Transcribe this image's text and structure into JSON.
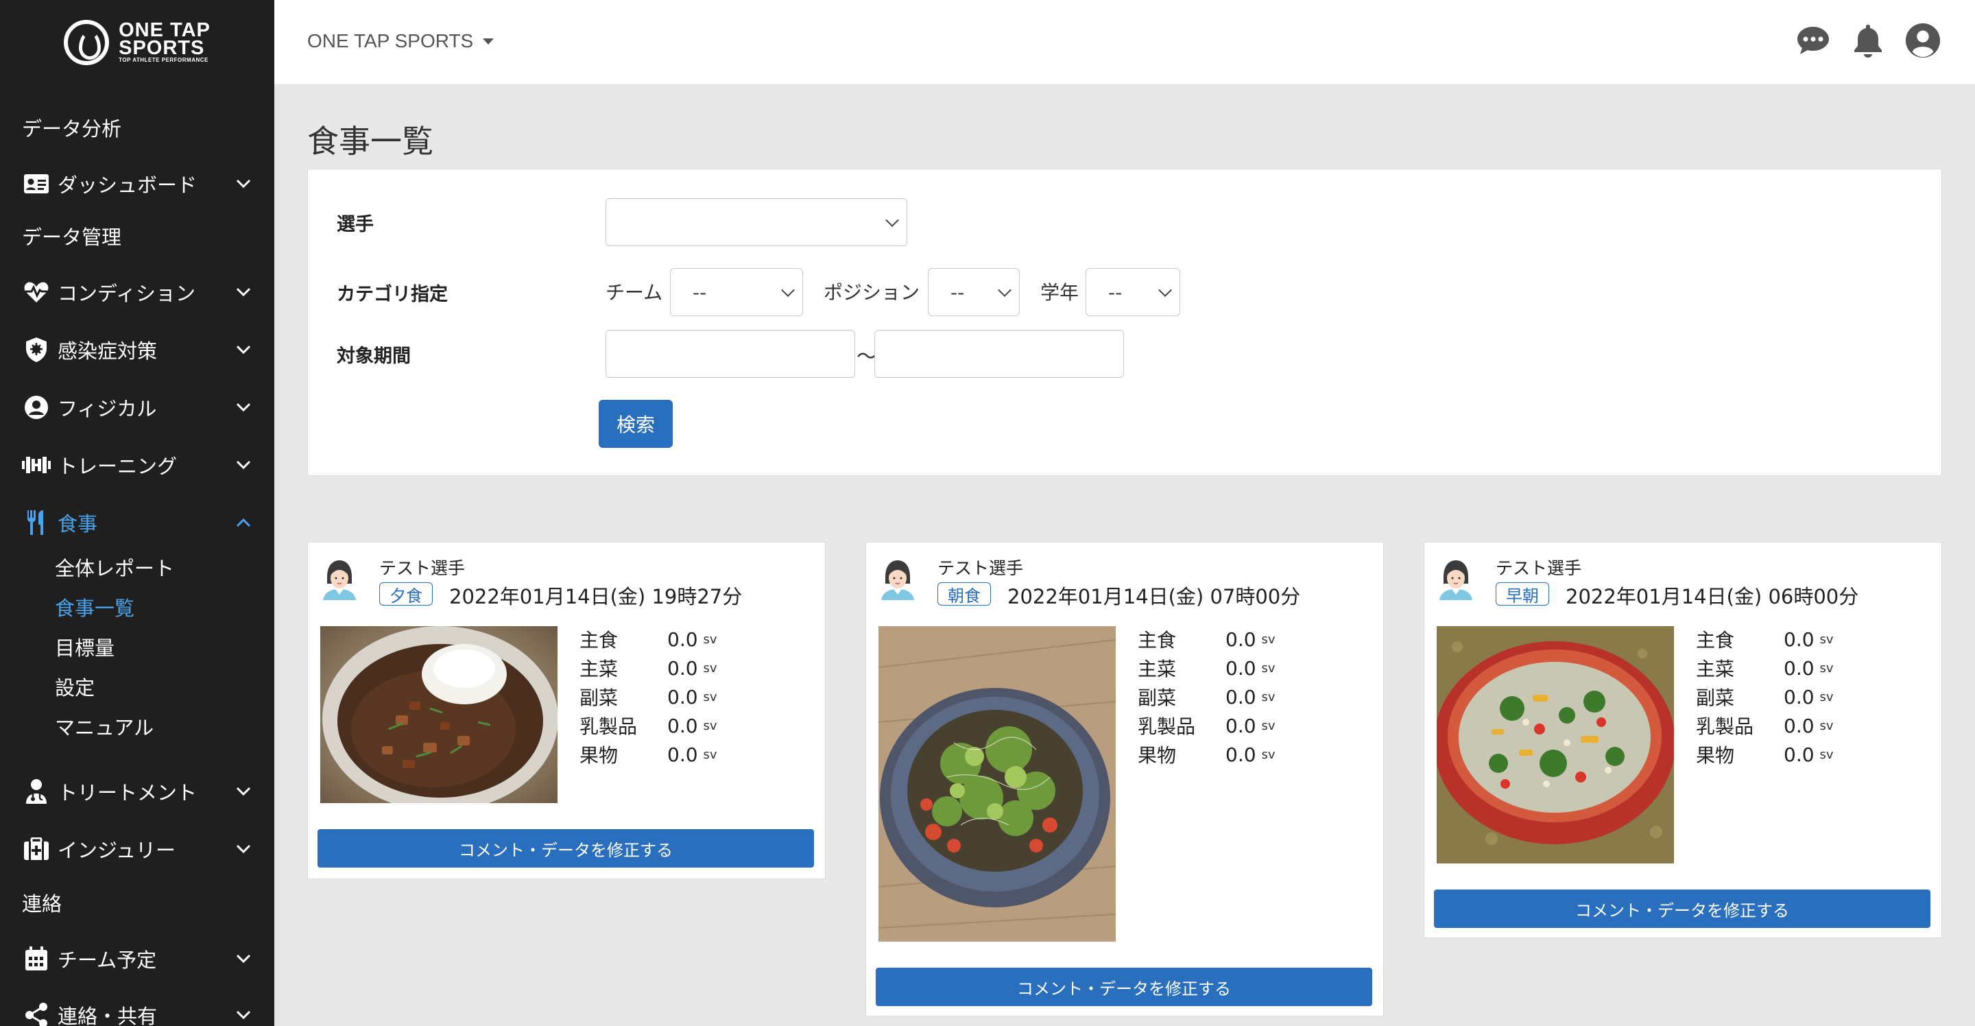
{
  "app": {
    "logo_line1": "ONE TAP",
    "logo_line2": "SPORTS",
    "logo_tagline": "TOP ATHLETE PERFORMANCE",
    "brand_dropdown": "ONE TAP SPORTS"
  },
  "sidebar": {
    "items": [
      {
        "label": "データ分析"
      },
      {
        "label": "ダッシュボード",
        "icon": "id-card-icon"
      },
      {
        "label": "データ管理"
      },
      {
        "label": "コンディション",
        "icon": "heart-pulse-icon"
      },
      {
        "label": "感染症対策",
        "icon": "virus-shield-icon"
      },
      {
        "label": "フィジカル",
        "icon": "user-circle-icon"
      },
      {
        "label": "トレーニング",
        "icon": "dumbbell-icon"
      },
      {
        "label": "食事",
        "icon": "utensils-icon",
        "active": true
      },
      {
        "label": "トリートメント",
        "icon": "medic-icon"
      },
      {
        "label": "インジュリー",
        "icon": "first-aid-icon"
      },
      {
        "label": "連絡"
      },
      {
        "label": "チーム予定",
        "icon": "calendar-icon"
      },
      {
        "label": "連絡・共有",
        "icon": "share-icon"
      }
    ],
    "meal_subitems": [
      {
        "label": "全体レポート"
      },
      {
        "label": "食事一覧",
        "active": true
      },
      {
        "label": "目標量"
      },
      {
        "label": "設定"
      },
      {
        "label": "マニュアル"
      }
    ]
  },
  "topbar_icons": [
    "chat-icon",
    "bell-icon",
    "account-icon"
  ],
  "page": {
    "title": "食事一覧"
  },
  "search": {
    "player_label": "選手",
    "player_value": "",
    "category_label": "カテゴリ指定",
    "team_label": "チーム",
    "team_value": "--",
    "position_label": "ポジション",
    "position_value": "--",
    "grade_label": "学年",
    "grade_value": "--",
    "period_label": "対象期間",
    "period_separator": "〜",
    "period_from": "",
    "period_to": "",
    "search_button": "検索"
  },
  "meals": [
    {
      "player": "テスト選手",
      "meal_type": "夕食",
      "datetime": "2022年01月14日(金) 19時27分",
      "photo": "curry-rice-photo",
      "nutrients": [
        {
          "name": "主食",
          "value": "0.0",
          "unit": "sv"
        },
        {
          "name": "主菜",
          "value": "0.0",
          "unit": "sv"
        },
        {
          "name": "副菜",
          "value": "0.0",
          "unit": "sv"
        },
        {
          "name": "乳製品",
          "value": "0.0",
          "unit": "sv"
        },
        {
          "name": "果物",
          "value": "0.0",
          "unit": "sv"
        }
      ],
      "edit_button": "コメント・データを修正する"
    },
    {
      "player": "テスト選手",
      "meal_type": "朝食",
      "datetime": "2022年01月14日(金) 07時00分",
      "photo": "soba-salad-photo",
      "nutrients": [
        {
          "name": "主食",
          "value": "0.0",
          "unit": "sv"
        },
        {
          "name": "主菜",
          "value": "0.0",
          "unit": "sv"
        },
        {
          "name": "副菜",
          "value": "0.0",
          "unit": "sv"
        },
        {
          "name": "乳製品",
          "value": "0.0",
          "unit": "sv"
        },
        {
          "name": "果物",
          "value": "0.0",
          "unit": "sv"
        }
      ],
      "edit_button": "コメント・データを修正する"
    },
    {
      "player": "テスト選手",
      "meal_type": "早朝",
      "datetime": "2022年01月14日(金) 06時00分",
      "photo": "salad-bowl-photo",
      "nutrients": [
        {
          "name": "主食",
          "value": "0.0",
          "unit": "sv"
        },
        {
          "name": "主菜",
          "value": "0.0",
          "unit": "sv"
        },
        {
          "name": "副菜",
          "value": "0.0",
          "unit": "sv"
        },
        {
          "name": "乳製品",
          "value": "0.0",
          "unit": "sv"
        },
        {
          "name": "果物",
          "value": "0.0",
          "unit": "sv"
        }
      ],
      "edit_button": "コメント・データを修正する"
    }
  ],
  "colors": {
    "sidebar_bg": "#1f1f1f",
    "accent": "#2a6fbe",
    "active_nav": "#4aa3ea",
    "page_bg": "#e8e8e8"
  }
}
